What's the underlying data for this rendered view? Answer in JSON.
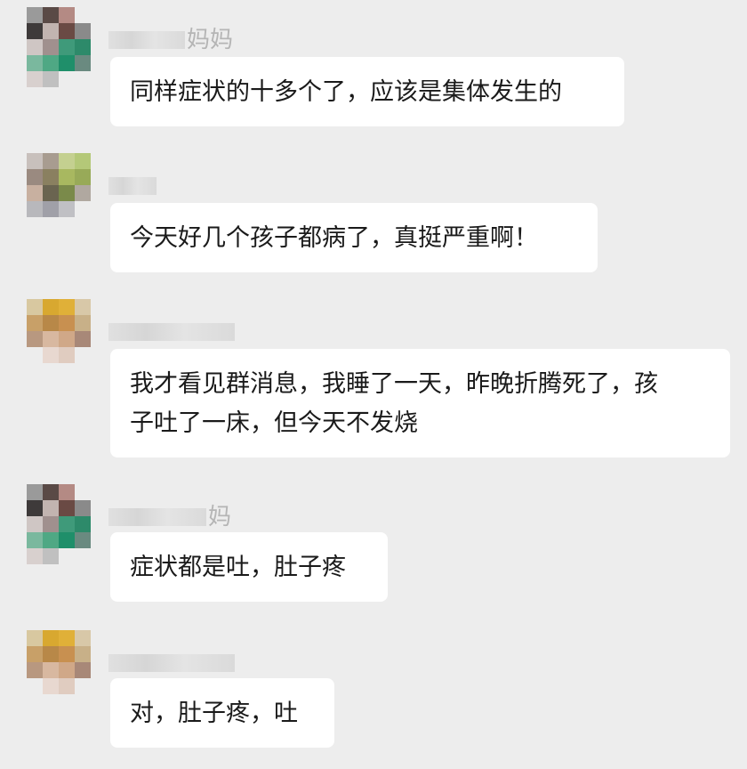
{
  "messages": [
    {
      "name_suffix": "妈妈",
      "text": "同样症状的十多个了，应该是集体发生的"
    },
    {
      "name_suffix": "",
      "text": "今天好几个孩子都病了，真挺严重啊！"
    },
    {
      "name_suffix": "",
      "text": "我才看见群消息，我睡了一天，昨晚折腾死了，孩\n子吐了一床，但今天不发烧"
    },
    {
      "name_suffix": "妈",
      "text": "症状都是吐，肚子疼"
    },
    {
      "name_suffix": "",
      "text": "对，肚子疼，吐"
    }
  ]
}
